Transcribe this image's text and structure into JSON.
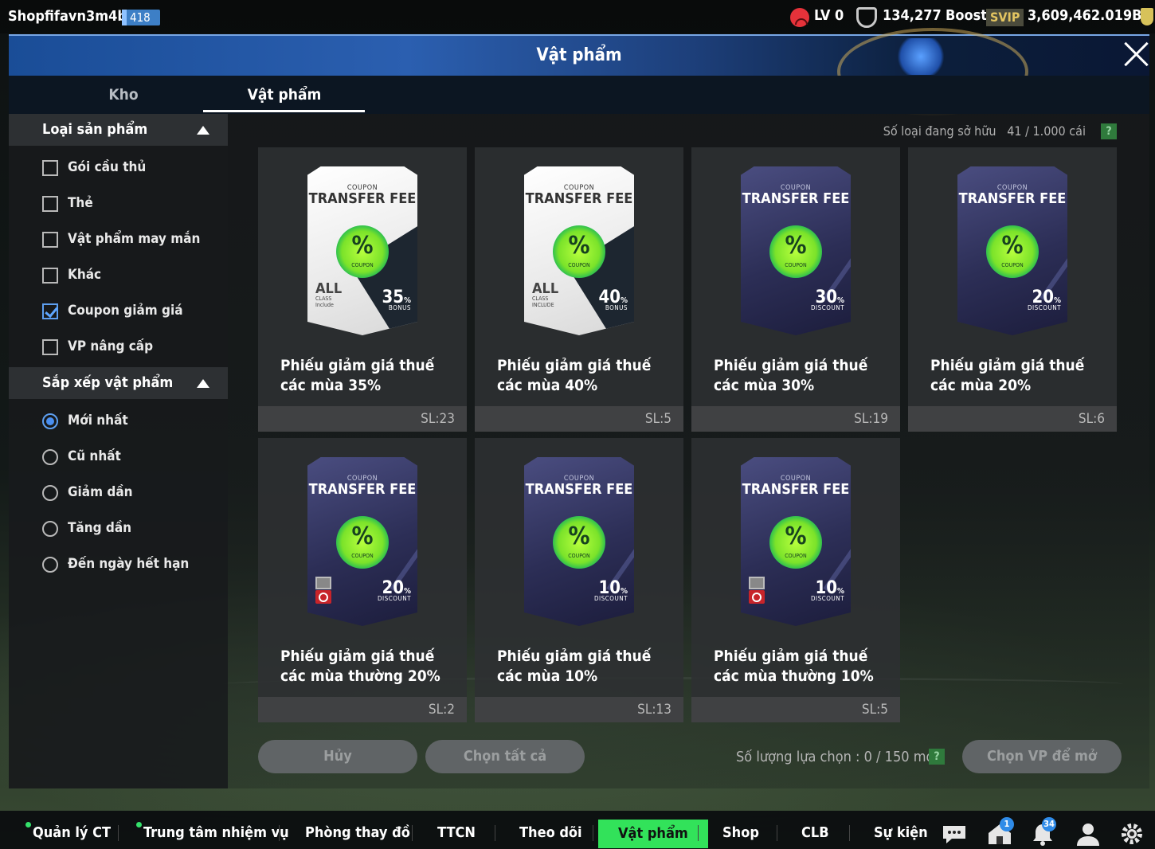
{
  "topbar": {
    "username": "Shopfifavn3m4bp",
    "level_badge": "418",
    "lv": "LV 0",
    "trophies": "134,277",
    "boost": "Boost",
    "svip": "SVIP",
    "balance": "3,609,462.019B"
  },
  "header": {
    "title": "Vật phẩm"
  },
  "tabs": [
    {
      "label": "Kho"
    },
    {
      "label": "Vật phẩm"
    }
  ],
  "sidebar": {
    "category_title": "Loại sản phẩm",
    "categories": [
      {
        "label": "Gói cầu thủ",
        "checked": false
      },
      {
        "label": "Thẻ",
        "checked": false
      },
      {
        "label": "Vật phẩm may mắn",
        "checked": false
      },
      {
        "label": "Khác",
        "checked": false
      },
      {
        "label": "Coupon giảm giá",
        "checked": true
      },
      {
        "label": "VP nâng cấp",
        "checked": false
      }
    ],
    "sort_title": "Sắp xếp vật phẩm",
    "sorts": [
      {
        "label": "Mới nhất",
        "selected": true
      },
      {
        "label": "Cũ nhất",
        "selected": false
      },
      {
        "label": "Giảm dần",
        "selected": false
      },
      {
        "label": "Tăng dần",
        "selected": false
      },
      {
        "label": "Đến ngày hết hạn",
        "selected": false
      }
    ]
  },
  "main": {
    "owned_label": "Số loại đang sở hữu",
    "owned_value": "41 / 1.000 cái",
    "help": "?",
    "items": [
      {
        "coupon_small": "COUPON",
        "coupon_big": "TRANSFER FEE",
        "style": "white",
        "percent": "%",
        "coupon_tag": "COUPON",
        "value": "35",
        "unit": "%",
        "sub": "BONUS",
        "left_big": "ALL",
        "left_sub1": "CLASS",
        "left_sub2": "Include",
        "name": "Phiếu giảm giá thuế các mùa 35%",
        "qty": "SL:23"
      },
      {
        "coupon_small": "COUPON",
        "coupon_big": "TRANSFER FEE",
        "style": "white",
        "percent": "%",
        "coupon_tag": "COUPON",
        "value": "40",
        "unit": "%",
        "sub": "BONUS",
        "left_big": "ALL",
        "left_sub1": "CLASS",
        "left_sub2": "INCLUDE",
        "name": "Phiếu giảm giá thuế các mùa 40%",
        "qty": "SL:5"
      },
      {
        "coupon_small": "COUPON",
        "coupon_big": "TRANSFER FEE",
        "style": "dark",
        "percent": "%",
        "coupon_tag": "COUPON",
        "value": "30",
        "unit": "%",
        "sub": "DISCOUNT",
        "name": "Phiếu giảm giá thuế các mùa 30%",
        "qty": "SL:19"
      },
      {
        "coupon_small": "COUPON",
        "coupon_big": "TRANSFER FEE",
        "style": "dark",
        "percent": "%",
        "coupon_tag": "COUPON",
        "value": "20",
        "unit": "%",
        "sub": "DISCOUNT",
        "name": "Phiếu giảm giá thuế các mùa 20%",
        "qty": "SL:6"
      },
      {
        "coupon_small": "COUPON",
        "coupon_big": "TRANSFER FEE",
        "style": "dark",
        "percent": "%",
        "coupon_tag": "COUPON",
        "value": "20",
        "unit": "%",
        "sub": "DISCOUNT",
        "blocked": true,
        "name": "Phiếu giảm giá thuế các mùa thường 20%",
        "qty": "SL:2"
      },
      {
        "coupon_small": "COUPON",
        "coupon_big": "TRANSFER FEE",
        "style": "dark",
        "percent": "%",
        "coupon_tag": "COUPON",
        "value": "10",
        "unit": "%",
        "sub": "DISCOUNT",
        "name": "Phiếu giảm giá thuế các mùa 10%",
        "qty": "SL:13"
      },
      {
        "coupon_small": "COUPON",
        "coupon_big": "TRANSFER FEE",
        "style": "dark",
        "percent": "%",
        "coupon_tag": "COUPON",
        "value": "10",
        "unit": "%",
        "sub": "DISCOUNT",
        "blocked": true,
        "name": "Phiếu giảm giá thuế các mùa thường 10%",
        "qty": "SL:5"
      }
    ],
    "cancel_label": "Hủy",
    "select_all_label": "Chọn tất cả",
    "selection_label": "Số lượng lựa chọn : 0 / 150 món",
    "open_label": "Chọn VP để mở"
  },
  "bottomnav": [
    {
      "label": "Quản lý CT"
    },
    {
      "label": "Trung tâm nhiệm vụ"
    },
    {
      "label": "Phòng thay đồ"
    },
    {
      "label": "TTCN"
    },
    {
      "label": "Theo dõi"
    },
    {
      "label": "Vật phẩm"
    },
    {
      "label": "Shop"
    },
    {
      "label": "CLB"
    },
    {
      "label": "Sự kiện"
    }
  ],
  "badges": {
    "house": "1",
    "bell": "34"
  },
  "icons": [
    "chat-icon",
    "house-icon",
    "bell-icon",
    "profile-icon",
    "settings-icon"
  ]
}
